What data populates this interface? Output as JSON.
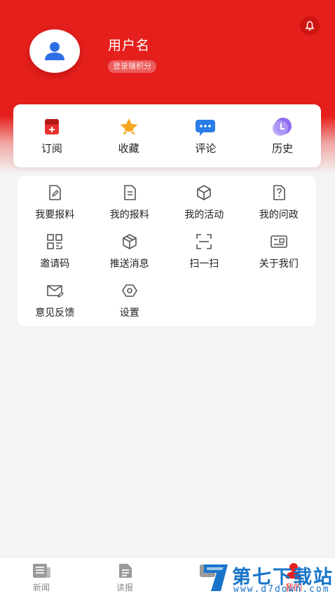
{
  "profile": {
    "username": "用户名",
    "login_prompt": "登录赚积分"
  },
  "quick_actions": [
    {
      "label": "订阅",
      "icon": "subscribe-icon"
    },
    {
      "label": "收藏",
      "icon": "star-icon"
    },
    {
      "label": "评论",
      "icon": "comment-icon"
    },
    {
      "label": "历史",
      "icon": "history-icon"
    }
  ],
  "menu": [
    {
      "label": "我要报料",
      "icon": "edit-document-icon"
    },
    {
      "label": "我的报料",
      "icon": "document-list-icon"
    },
    {
      "label": "我的活动",
      "icon": "cube-icon"
    },
    {
      "label": "我的问政",
      "icon": "question-document-icon"
    },
    {
      "label": "邀请码",
      "icon": "qr-grid-icon"
    },
    {
      "label": "推送消息",
      "icon": "box-icon"
    },
    {
      "label": "扫一扫",
      "icon": "scan-icon"
    },
    {
      "label": "关于我们",
      "icon": "id-card-icon"
    },
    {
      "label": "意见反馈",
      "icon": "feedback-mail-icon"
    },
    {
      "label": "设置",
      "icon": "settings-hexagon-icon"
    }
  ],
  "tabs": [
    {
      "label": "新闻",
      "icon": "newspaper-icon",
      "active": false
    },
    {
      "label": "读报",
      "icon": "read-paper-icon",
      "active": false
    },
    {
      "label": "",
      "icon": "media-icon",
      "active": false
    },
    {
      "label": "我的",
      "icon": "profile-tab-icon",
      "active": true
    }
  ],
  "watermark": {
    "title": "第七下载站",
    "url": "www.d7down.com"
  },
  "colors": {
    "brand_red": "#e51f1c",
    "menu_icon": "#555555",
    "watermark_blue": "#1774c9"
  }
}
